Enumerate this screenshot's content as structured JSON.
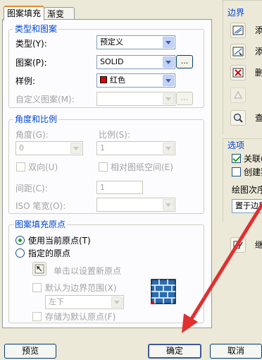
{
  "tabs": [
    "图案填充",
    "渐变色"
  ],
  "type_group": {
    "title": "类型和图案",
    "type_label": "类型(Y):",
    "type_value": "预定义",
    "pattern_label": "图案(P):",
    "pattern_value": "SOLID",
    "ellipsis": "...",
    "swatch_label": "样例:",
    "swatch_value": "红色",
    "swatch_color": "#E00000",
    "custom_label": "自定义图案(M):"
  },
  "angle_group": {
    "title": "角度和比例",
    "angle_label": "角度(G):",
    "angle_value": "0",
    "scale_label": "比例(S):",
    "scale_value": "1",
    "double_label": "双向(U)",
    "relative_label": "相对图纸空间(E)",
    "spacing_label": "间距(C):",
    "spacing_value": "1",
    "iso_label": "ISO 笔宽(O):"
  },
  "origin_group": {
    "title": "图案填充原点",
    "use_current": "使用当前原点(T)",
    "specified": "指定的原点",
    "click_set": "单击以设置新原点",
    "default_boundary": "默认为边界范围(X)",
    "position_value": "左下",
    "store_default": "存储为默认原点(F)"
  },
  "boundary": {
    "title": "边界",
    "btn1": "添",
    "btn2": "添",
    "btn3": "删"
  },
  "options": {
    "title": "选项",
    "assoc": "关联(",
    "create_sep": "创建独",
    "draw_order_label": "绘图次序",
    "draw_order_value": "置于边界"
  },
  "right_labels": {
    "view": "查",
    "inherit": "继"
  },
  "buttons": {
    "preview": "预览",
    "ok": "确定",
    "cancel": "取消"
  },
  "annotation_color": "#E03030"
}
